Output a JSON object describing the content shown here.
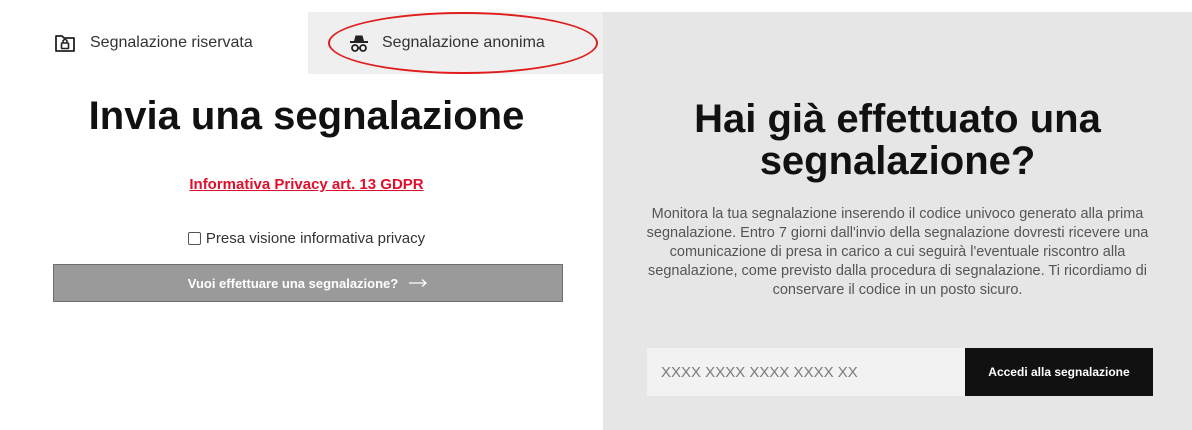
{
  "tabs": {
    "reserved_label": "Segnalazione riservata",
    "anonymous_label": "Segnalazione anonima"
  },
  "left": {
    "title": "Invia una segnalazione",
    "privacy_link": "Informativa Privacy art. 13 GDPR",
    "consent_label": "Presa visione informativa privacy",
    "cta_label": "Vuoi effettuare una segnalazione?"
  },
  "right": {
    "title": "Hai già effettuato una segnalazione?",
    "description": "Monitora la tua segnalazione inserendo il codice univoco generato alla prima segnalazione. Entro 7 giorni dall'invio della segnalazione dovresti ricevere una comunicazione di presa in carico a cui seguirà l'eventuale riscontro alla segnalazione, come previsto dalla procedura di segnalazione. Ti ricordiamo di conservare il codice in un posto sicuro.",
    "code_placeholder": "XXXX XXXX XXXX XXXX XX",
    "access_button": "Accedi alla segnalazione"
  },
  "icons": {
    "reserved_tab": "lock-folder-icon",
    "anonymous_tab": "incognito-icon",
    "cta": "arrow-right-icon"
  },
  "colors": {
    "link": "#e0102c",
    "highlight": "#e01d1d",
    "cta_bg": "#9a9a9a",
    "access_bg": "#111111",
    "right_panel_bg": "#e6e6e6"
  }
}
